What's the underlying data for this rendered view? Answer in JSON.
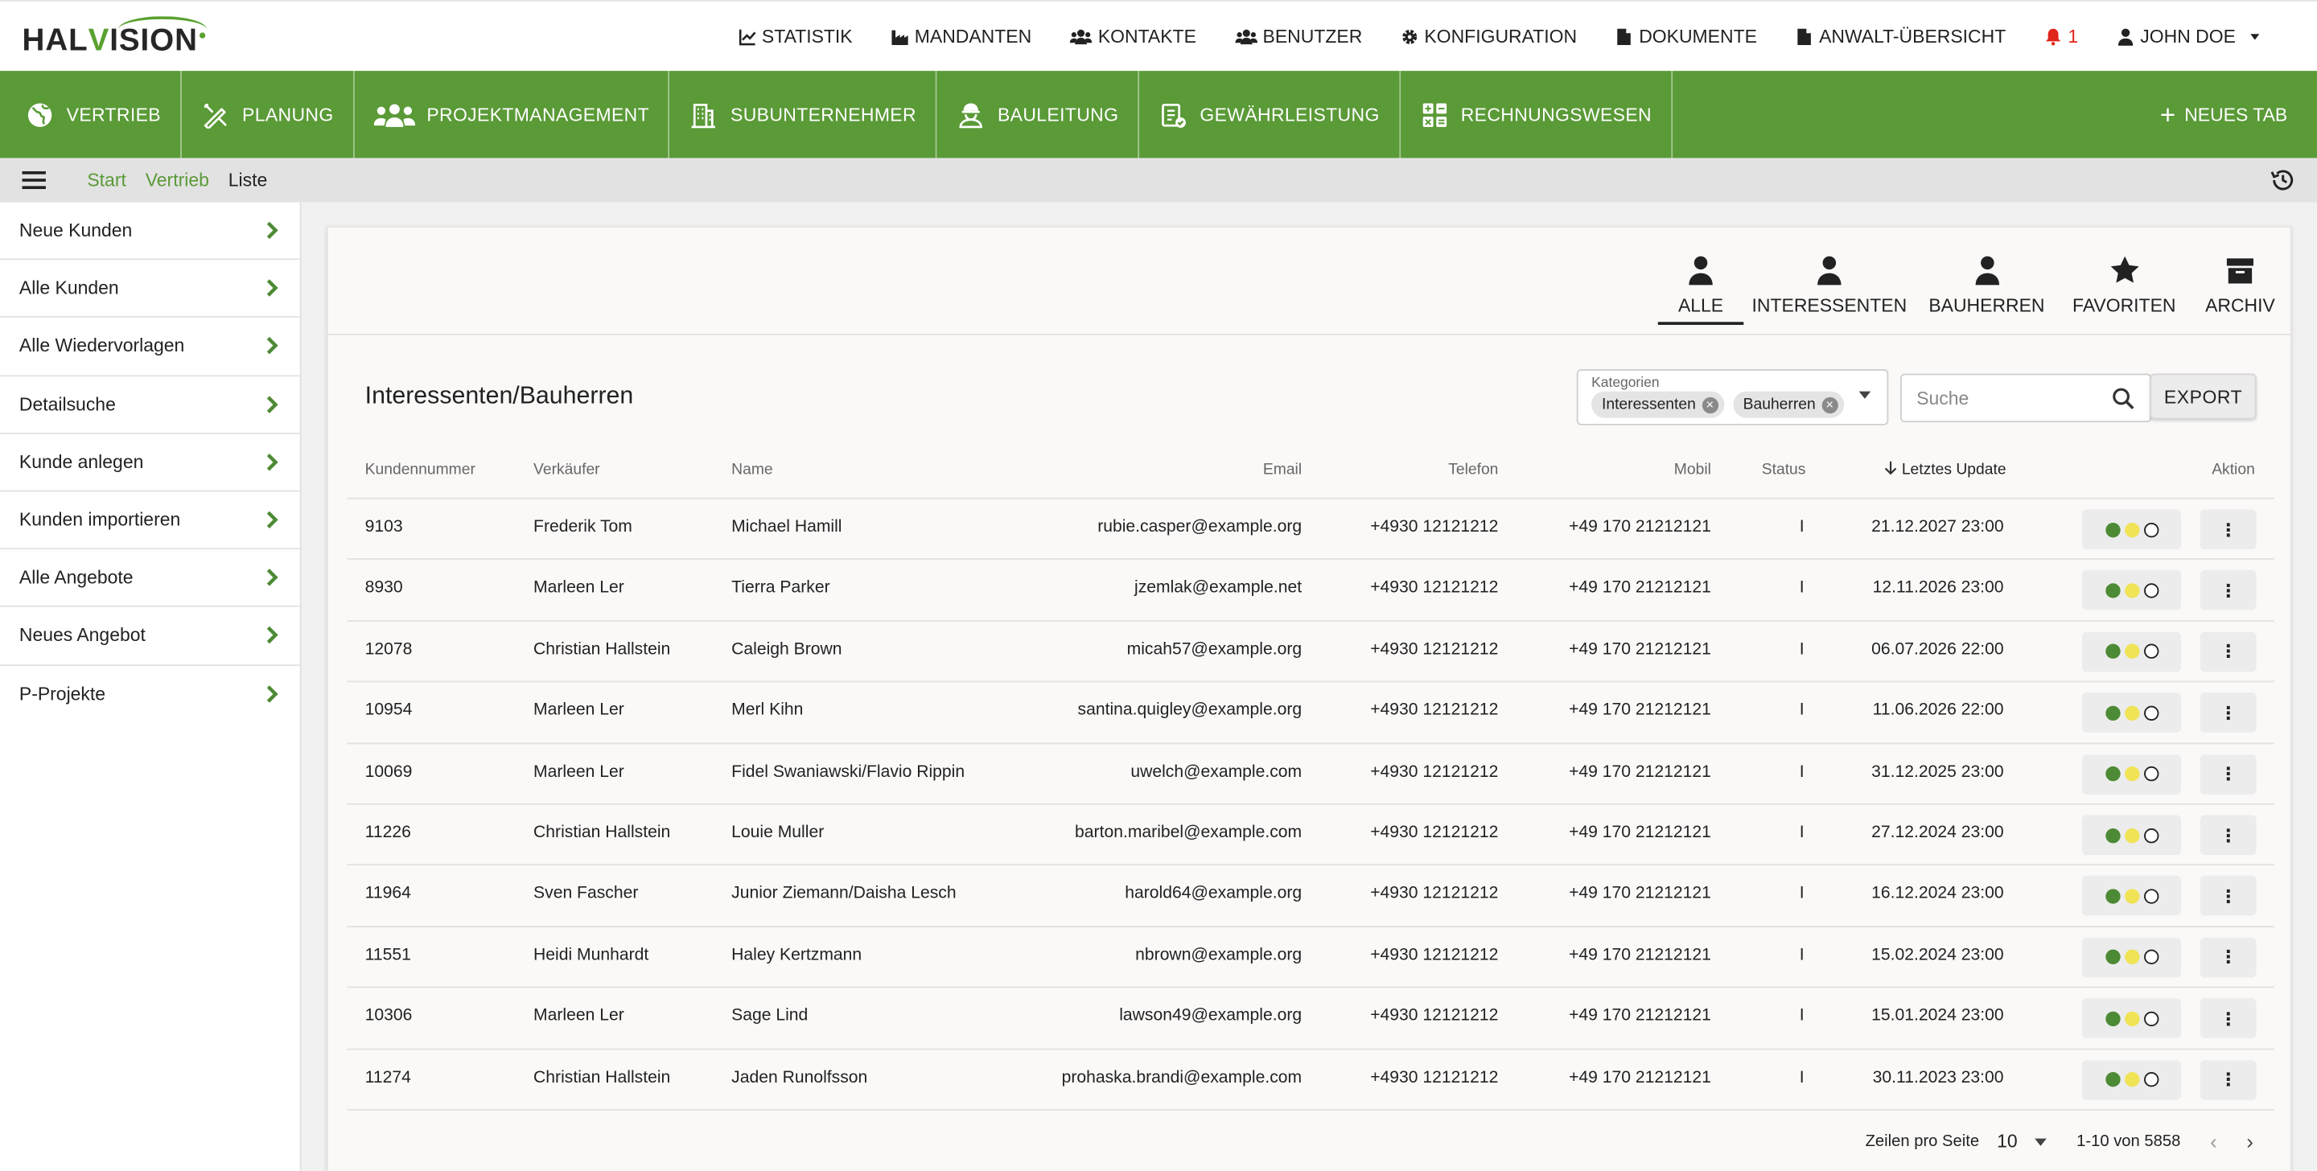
{
  "app": {
    "logo_text_pre": "HAL",
    "logo_text_v": "V",
    "logo_text_post": "ISION"
  },
  "topnav": {
    "items": [
      {
        "label": "STATISTIK",
        "icon": "chart-line-icon"
      },
      {
        "label": "MANDANTEN",
        "icon": "factory-icon"
      },
      {
        "label": "KONTAKTE",
        "icon": "users-icon"
      },
      {
        "label": "BENUTZER",
        "icon": "user-group-icon"
      },
      {
        "label": "KONFIGURATION",
        "icon": "gear-icon"
      },
      {
        "label": "DOKUMENTE",
        "icon": "file-icon"
      },
      {
        "label": "ANWALT-ÜBERSICHT",
        "icon": "file-icon"
      }
    ],
    "notifications_count": "1",
    "user_name": "JOHN DOE"
  },
  "modules": [
    {
      "label": "VERTRIEB",
      "icon": "globe-icon"
    },
    {
      "label": "PLANUNG",
      "icon": "drafting-tools-icon"
    },
    {
      "label": "PROJEKTMANAGEMENT",
      "icon": "team-icon"
    },
    {
      "label": "SUBUNTERNEHMER",
      "icon": "building-icon"
    },
    {
      "label": "BAULEITUNG",
      "icon": "worker-icon"
    },
    {
      "label": "GEWÄHRLEISTUNG",
      "icon": "clipboard-check-icon"
    },
    {
      "label": "RECHNUNGSWESEN",
      "icon": "calculator-icon"
    }
  ],
  "new_tab_label": "NEUES TAB",
  "breadcrumb": {
    "start": "Start",
    "vertrieb": "Vertrieb",
    "current": "Liste"
  },
  "sidebar": {
    "items": [
      {
        "label": "Neue Kunden"
      },
      {
        "label": "Alle Kunden"
      },
      {
        "label": "Alle Wiedervorlagen"
      },
      {
        "label": "Detailsuche"
      },
      {
        "label": "Kunde anlegen"
      },
      {
        "label": "Kunden importieren"
      },
      {
        "label": "Alle Angebote"
      },
      {
        "label": "Neues Angebot"
      },
      {
        "label": "P-Projekte"
      }
    ]
  },
  "tabs": [
    {
      "label": "ALLE",
      "icon": "person-icon"
    },
    {
      "label": "INTERESSENTEN",
      "icon": "person-icon"
    },
    {
      "label": "BAUHERREN",
      "icon": "person-icon"
    },
    {
      "label": "FAVORITEN",
      "icon": "star-icon"
    },
    {
      "label": "ARCHIV",
      "icon": "archive-icon"
    }
  ],
  "page_title": "Interessenten/Bauherren",
  "filter": {
    "label": "Kategorien",
    "chips": [
      "Interessenten",
      "Bauherren"
    ]
  },
  "search": {
    "placeholder": "Suche"
  },
  "export_label": "EXPORT",
  "table": {
    "headers": {
      "kundennummer": "Kundennummer",
      "verkaeufer": "Verkäufer",
      "name": "Name",
      "email": "Email",
      "telefon": "Telefon",
      "mobil": "Mobil",
      "status": "Status",
      "update": "Letztes Update",
      "aktion": "Aktion"
    },
    "rows": [
      {
        "nr": "9103",
        "verk": "Frederik Tom",
        "name": "Michael Hamill",
        "email": "rubie.casper@example.org",
        "tel": "+4930 12121212",
        "mob": "+49 170 21212121",
        "status": "I",
        "upd": "21.12.2027 23:00"
      },
      {
        "nr": "8930",
        "verk": "Marleen Ler",
        "name": "Tierra Parker",
        "email": "jzemlak@example.net",
        "tel": "+4930 12121212",
        "mob": "+49 170 21212121",
        "status": "I",
        "upd": "12.11.2026 23:00"
      },
      {
        "nr": "12078",
        "verk": "Christian Hallstein",
        "name": "Caleigh Brown",
        "email": "micah57@example.org",
        "tel": "+4930 12121212",
        "mob": "+49 170 21212121",
        "status": "I",
        "upd": "06.07.2026 22:00"
      },
      {
        "nr": "10954",
        "verk": "Marleen Ler",
        "name": "Merl Kihn",
        "email": "santina.quigley@example.org",
        "tel": "+4930 12121212",
        "mob": "+49 170 21212121",
        "status": "I",
        "upd": "11.06.2026 22:00"
      },
      {
        "nr": "10069",
        "verk": "Marleen Ler",
        "name": "Fidel Swaniawski/Flavio Rippin",
        "email": "uwelch@example.com",
        "tel": "+4930 12121212",
        "mob": "+49 170 21212121",
        "status": "I",
        "upd": "31.12.2025 23:00"
      },
      {
        "nr": "11226",
        "verk": "Christian Hallstein",
        "name": "Louie Muller",
        "email": "barton.maribel@example.com",
        "tel": "+4930 12121212",
        "mob": "+49 170 21212121",
        "status": "I",
        "upd": "27.12.2024 23:00"
      },
      {
        "nr": "11964",
        "verk": "Sven Fascher",
        "name": "Junior Ziemann/Daisha Lesch",
        "email": "harold64@example.org",
        "tel": "+4930 12121212",
        "mob": "+49 170 21212121",
        "status": "I",
        "upd": "16.12.2024 23:00"
      },
      {
        "nr": "11551",
        "verk": "Heidi Munhardt",
        "name": "Haley Kertzmann",
        "email": "nbrown@example.org",
        "tel": "+4930 12121212",
        "mob": "+49 170 21212121",
        "status": "I",
        "upd": "15.02.2024 23:00"
      },
      {
        "nr": "10306",
        "verk": "Marleen Ler",
        "name": "Sage Lind",
        "email": "lawson49@example.org",
        "tel": "+4930 12121212",
        "mob": "+49 170 21212121",
        "status": "I",
        "upd": "15.01.2024 23:00"
      },
      {
        "nr": "11274",
        "verk": "Christian Hallstein",
        "name": "Jaden Runolfsson",
        "email": "prohaska.brandi@example.com",
        "tel": "+4930 12121212",
        "mob": "+49 170 21212121",
        "status": "I",
        "upd": "30.11.2023 23:00"
      }
    ]
  },
  "pagination": {
    "rows_label": "Zeilen pro Seite",
    "rows_value": "10",
    "range": "1-10 von 5858"
  },
  "colors": {
    "brand_green": "#5a9a37",
    "alert_red": "#e0251b"
  }
}
